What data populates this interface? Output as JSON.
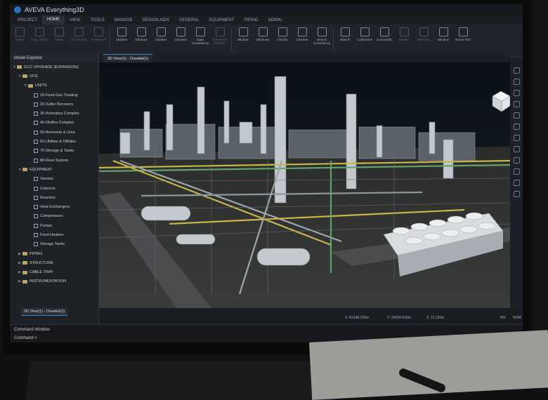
{
  "app": {
    "title": "AVEVA Everything3D"
  },
  "menu": [
    "PROJECT",
    "HOME",
    "VIEW",
    "TOOLS",
    "MANAGE",
    "DESIGN AIDS",
    "GENERAL",
    "EQUIPMENT",
    "PIPING",
    "ADMIN"
  ],
  "active_menu": "HOME",
  "ribbon": [
    {
      "label": "Select",
      "dim": true
    },
    {
      "label": "Copy Offset",
      "dim": true
    },
    {
      "label": "Delete",
      "dim": true
    },
    {
      "label": "3D Overlap",
      "dim": true
    },
    {
      "label": "Properties",
      "dim": true
    },
    {
      "label": "Clashes",
      "dim": false
    },
    {
      "label": "Obstruct",
      "dim": false
    },
    {
      "label": "Clashes",
      "dim": false
    },
    {
      "label": "Checker",
      "dim": false
    },
    {
      "label": "Data Consistency",
      "dim": false
    },
    {
      "label": "Reference Checker",
      "dim": true
    },
    {
      "label": "Window",
      "dim": false
    },
    {
      "label": "Windows",
      "dim": false
    },
    {
      "label": "Checks",
      "dim": false
    },
    {
      "label": "Checker",
      "dim": false
    },
    {
      "label": "Search Consistency",
      "dim": false
    },
    {
      "label": "Search",
      "dim": false
    },
    {
      "label": "Collections",
      "dim": false
    },
    {
      "label": "Comments",
      "dim": false
    },
    {
      "label": "Display",
      "dim": true
    },
    {
      "label": "Windows",
      "dim": true
    },
    {
      "label": "Window",
      "dim": false
    },
    {
      "label": "Room Text",
      "dim": false
    }
  ],
  "explorer": {
    "title": "Model Explorer",
    "tree": [
      {
        "label": "GCC UPGRADE (EXPANSION)",
        "level": 0,
        "kind": "folder",
        "tw": "▼"
      },
      {
        "label": "SITE",
        "level": 1,
        "kind": "folder",
        "tw": "▼"
      },
      {
        "label": "UNITS",
        "level": 2,
        "kind": "folder",
        "tw": "▼"
      },
      {
        "label": "10-Feed Gas Treating",
        "level": 3,
        "kind": "doc",
        "tw": ""
      },
      {
        "label": "20-Sulfur Recovery",
        "level": 3,
        "kind": "doc",
        "tw": ""
      },
      {
        "label": "30-Aromatics Complex",
        "level": 3,
        "kind": "doc",
        "tw": ""
      },
      {
        "label": "40-Olefins Complex",
        "level": 3,
        "kind": "doc",
        "tw": ""
      },
      {
        "label": "50-Ammonia & Urea",
        "level": 3,
        "kind": "doc",
        "tw": ""
      },
      {
        "label": "60-Utilities & Offsites",
        "level": 3,
        "kind": "doc",
        "tw": ""
      },
      {
        "label": "70-Storage & Tanks",
        "level": 3,
        "kind": "doc",
        "tw": ""
      },
      {
        "label": "80-Flare System",
        "level": 3,
        "kind": "doc",
        "tw": ""
      },
      {
        "label": "EQUIPMENT",
        "level": 1,
        "kind": "folder",
        "tw": "▼"
      },
      {
        "label": "Vessels",
        "level": 3,
        "kind": "doc",
        "tw": ""
      },
      {
        "label": "Columns",
        "level": 3,
        "kind": "doc",
        "tw": ""
      },
      {
        "label": "Reactors",
        "level": 3,
        "kind": "doc",
        "tw": ""
      },
      {
        "label": "Heat Exchangers",
        "level": 3,
        "kind": "doc",
        "tw": ""
      },
      {
        "label": "Compressors",
        "level": 3,
        "kind": "doc",
        "tw": ""
      },
      {
        "label": "Pumps",
        "level": 3,
        "kind": "doc",
        "tw": ""
      },
      {
        "label": "Fired Heaters",
        "level": 3,
        "kind": "doc",
        "tw": ""
      },
      {
        "label": "Storage Tanks",
        "level": 3,
        "kind": "doc",
        "tw": ""
      },
      {
        "label": "PIPING",
        "level": 1,
        "kind": "folder",
        "tw": "▶"
      },
      {
        "label": "STRUCTURE",
        "level": 1,
        "kind": "folder",
        "tw": "▶"
      },
      {
        "label": "CABLE TRAY",
        "level": 1,
        "kind": "folder",
        "tw": "▶"
      },
      {
        "label": "INSTRUMENTATION",
        "level": 1,
        "kind": "folder",
        "tw": "▶"
      }
    ]
  },
  "view_tab": "3D View(1) - Drawlist(1)",
  "bottom_tab": "3D View(1) - Drawlist(1)",
  "status": {
    "x": "X: 61348.136m",
    "y": "Y: 24058.810m",
    "z": "Z: 12.120m",
    "units": "MS",
    "extra": "NGM"
  },
  "command": {
    "title": "Command Window",
    "prompt": "Command >"
  },
  "colors": {
    "accent": "#3d7fd0",
    "pipe_yellow": "#c8b64a",
    "pipe_green": "#5fa36a",
    "steel": "#b8bec4"
  }
}
